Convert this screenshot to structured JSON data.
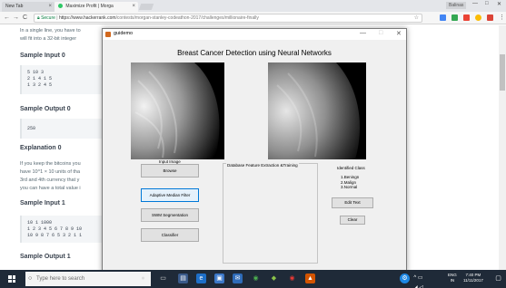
{
  "browser": {
    "tabs": [
      {
        "title": "New Tab"
      },
      {
        "title": "Maximize Profit | Morga"
      }
    ],
    "user": "Balinas",
    "window_controls": {
      "minimize": "—",
      "maximize": "□",
      "close": "✕"
    },
    "nav": {
      "back": "←",
      "forward": "→",
      "reload": "C"
    },
    "address": {
      "secure_label": "Secure",
      "url_host": "https://www.hackerrank.com",
      "url_path": "/contests/morgan-stanley-codeathon-2017/challenges/millionaire-finally"
    },
    "star": "☆"
  },
  "page": {
    "intro_line1": "In a single line, you have to",
    "intro_line2": "will fit into a 32-bit integer",
    "sample_input_0": {
      "heading": "Sample Input 0",
      "lines": [
        "5 10 3",
        "2 1 4 1 5",
        "1 3 2 4 5"
      ]
    },
    "sample_output_0": {
      "heading": "Sample Output 0",
      "lines": [
        "250"
      ]
    },
    "explanation_0": {
      "heading": "Explanation 0",
      "lines": [
        "If you keep the bitcoins you",
        "have 10^1 × 10 units of tha",
        "3rd and 4th currency that y",
        "you can have a total value i"
      ]
    },
    "sample_input_1": {
      "heading": "Sample Input 1",
      "lines": [
        "10 1 1000",
        "1 2 3 4 5 6 7 8 9 10",
        "10 9 8 7 6 5 3 2 1 1"
      ]
    },
    "sample_output_1": {
      "heading": "Sample Output 1"
    }
  },
  "gui": {
    "window_title": "guidemo",
    "heading": "Breast Cancer Detection using Neural Networks",
    "input_image_label": "Input Image",
    "buttons": {
      "browse": "Browse",
      "adaptive_median": "Adaptive Median Filter",
      "swm_segmentation": "SWM Segmentation",
      "classifier": "Classifier"
    },
    "panel_title": "Database Feature Extraction &Training",
    "identified_class": {
      "label": "Identified Class",
      "items": [
        "1.Beningn",
        "2.Malign",
        "3.Normal"
      ]
    },
    "edit_text": "Edit Text",
    "clear": "Clear"
  },
  "taskbar": {
    "search_placeholder": "Type here to search",
    "language": "ENG",
    "region": "IN",
    "time": "7:40 PM",
    "date": "11/11/2017"
  }
}
